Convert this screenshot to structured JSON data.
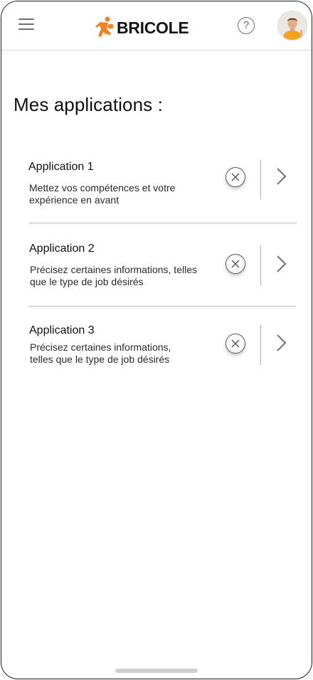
{
  "header": {
    "brand": "BRICOLE",
    "help_glyph": "?",
    "icons": [
      "menu-icon",
      "help-icon",
      "user-avatar"
    ],
    "brand_color": "#f58220"
  },
  "page": {
    "title": "Mes applications :"
  },
  "applications": [
    {
      "title": "Application 1",
      "description": "Mettez vos compétences et votre expérience en avant"
    },
    {
      "title": "Application 2",
      "description": "Précisez certaines informations, telles que le type de job désirés"
    },
    {
      "title": "Application 3",
      "description": "Précisez certaines informations, telles que le type de job désirés"
    }
  ]
}
